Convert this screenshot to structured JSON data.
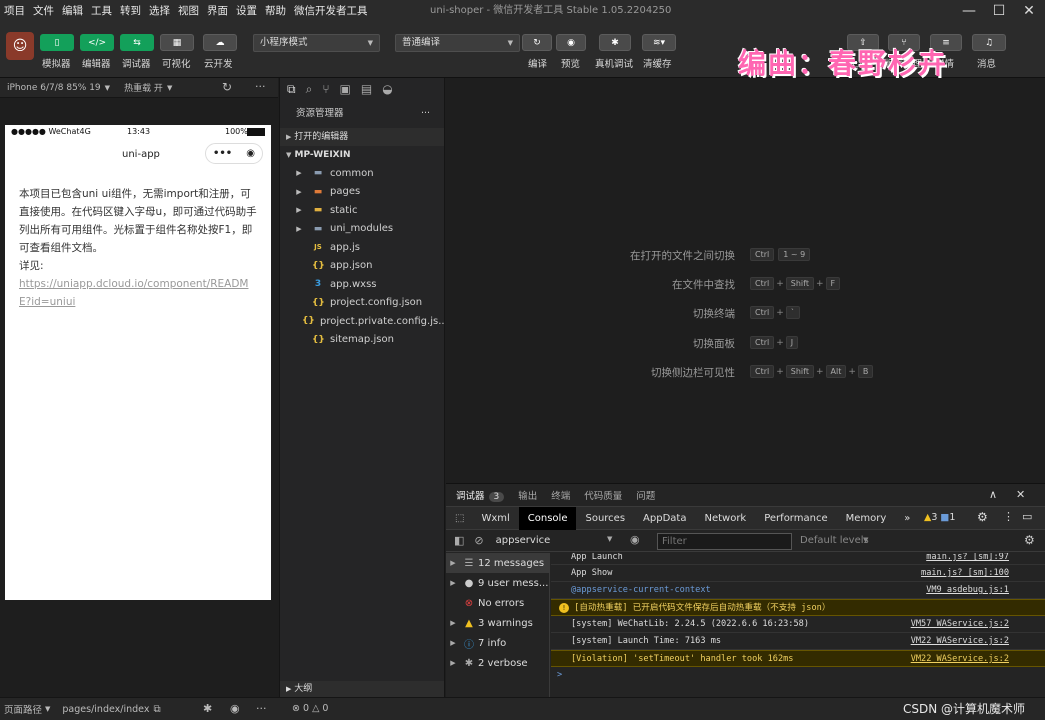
{
  "menubar": {
    "items": [
      "项目",
      "文件",
      "编辑",
      "工具",
      "转到",
      "选择",
      "视图",
      "界面",
      "设置",
      "帮助",
      "微信开发者工具"
    ],
    "window_title": "uni-shoper - 微信开发者工具 Stable 1.05.2204250"
  },
  "toolbar": {
    "left_buttons": [
      "模拟器",
      "编辑器",
      "调试器",
      "可视化",
      "云开发"
    ],
    "mode_select": "小程序模式",
    "compile_select": "普通编译",
    "mid_buttons": [
      "编译",
      "预览",
      "真机调试",
      "清缓存"
    ],
    "right_buttons": [
      "上传",
      "版本管理",
      "详情",
      "消息"
    ]
  },
  "watermark": "编曲：春野杉卉",
  "devicebar": {
    "device": "iPhone 6/7/8 85% 19",
    "hotreload": "热重载 开"
  },
  "phone": {
    "status_left": "●●●●● WeChat4G",
    "status_time": "13:43",
    "status_battery": "100%",
    "nav_title": "uni-app",
    "body_text": "本项目已包含uni ui组件，无需import和注册，可直接使用。在代码区键入字母u，即可通过代码助手列出所有可用组件。光标置于组件名称处按F1，即可查看组件文档。",
    "detail_label": "详见:",
    "link": "https://uniapp.dcloud.io/component/README?id=uniui"
  },
  "explorer": {
    "title": "资源管理器",
    "open_editors": "打开的编辑器",
    "project": "MP-WEIXIN",
    "folders": [
      "common",
      "pages",
      "static",
      "uni_modules"
    ],
    "files": [
      "app.js",
      "app.json",
      "app.wxss",
      "project.config.json",
      "project.private.config.js...",
      "sitemap.json"
    ],
    "outline": "大纲"
  },
  "shortcuts": [
    {
      "label": "在打开的文件之间切换",
      "keys": [
        "Ctrl",
        "1 ~ 9"
      ]
    },
    {
      "label": "在文件中查找",
      "keys": [
        "Ctrl",
        "Shift",
        "F"
      ]
    },
    {
      "label": "切换终端",
      "keys": [
        "Ctrl",
        "`"
      ]
    },
    {
      "label": "切换面板",
      "keys": [
        "Ctrl",
        "J"
      ]
    },
    {
      "label": "切换侧边栏可见性",
      "keys": [
        "Ctrl",
        "Shift",
        "Alt",
        "B"
      ]
    }
  ],
  "debugger": {
    "tabs": [
      "调试器",
      "输出",
      "终端",
      "代码质量",
      "问题"
    ],
    "debug_badge": "3",
    "devtools_tabs": [
      "Wxml",
      "Console",
      "Sources",
      "AppData",
      "Network",
      "Performance",
      "Memory"
    ],
    "more": "»",
    "warn_count": "3",
    "msg_count": "1",
    "context": "appservice",
    "filter_placeholder": "Filter",
    "levels": "Default levels",
    "sidebar": [
      {
        "label": "12 messages",
        "icon": "list-icon"
      },
      {
        "label": "9 user mess...",
        "icon": "user-icon"
      },
      {
        "label": "No errors",
        "icon": "error-icon"
      },
      {
        "label": "3 warnings",
        "icon": "warning-icon"
      },
      {
        "label": "7 info",
        "icon": "info-icon"
      },
      {
        "label": "2 verbose",
        "icon": "bug-icon"
      }
    ],
    "logs": [
      {
        "text": "App Launch",
        "src": "main.js? [sm]:97",
        "type": "normal"
      },
      {
        "text": "App Show",
        "src": "main.js? [sm]:100",
        "type": "normal"
      },
      {
        "text": "@appservice-current-context",
        "src": "VM9 asdebug.js:1",
        "type": "blue"
      },
      {
        "text": "[自动热重载] 已开启代码文件保存后自动热重载（不支持 json）",
        "src": "",
        "type": "warn"
      },
      {
        "text": "[system] WeChatLib: 2.24.5 (2022.6.6 16:23:58)",
        "src": "VM57 WAService.js:2",
        "type": "normal"
      },
      {
        "text": "[system] Launch Time: 7163 ms",
        "src": "VM22 WAService.js:2",
        "type": "normal"
      },
      {
        "text": "[Violation] 'setTimeout' handler took 162ms",
        "src": "VM22 WAService.js:2",
        "type": "warn"
      }
    ],
    "prompt": ">"
  },
  "statusbar": {
    "path_label": "页面路径",
    "page": "pages/index/index",
    "errors": "0",
    "warnings": "0",
    "credit": "CSDN @计算机魔术师"
  },
  "colors": {
    "accent": "#13a05a",
    "watermark": "#ff66b2",
    "warn_bg": "#332b00"
  }
}
